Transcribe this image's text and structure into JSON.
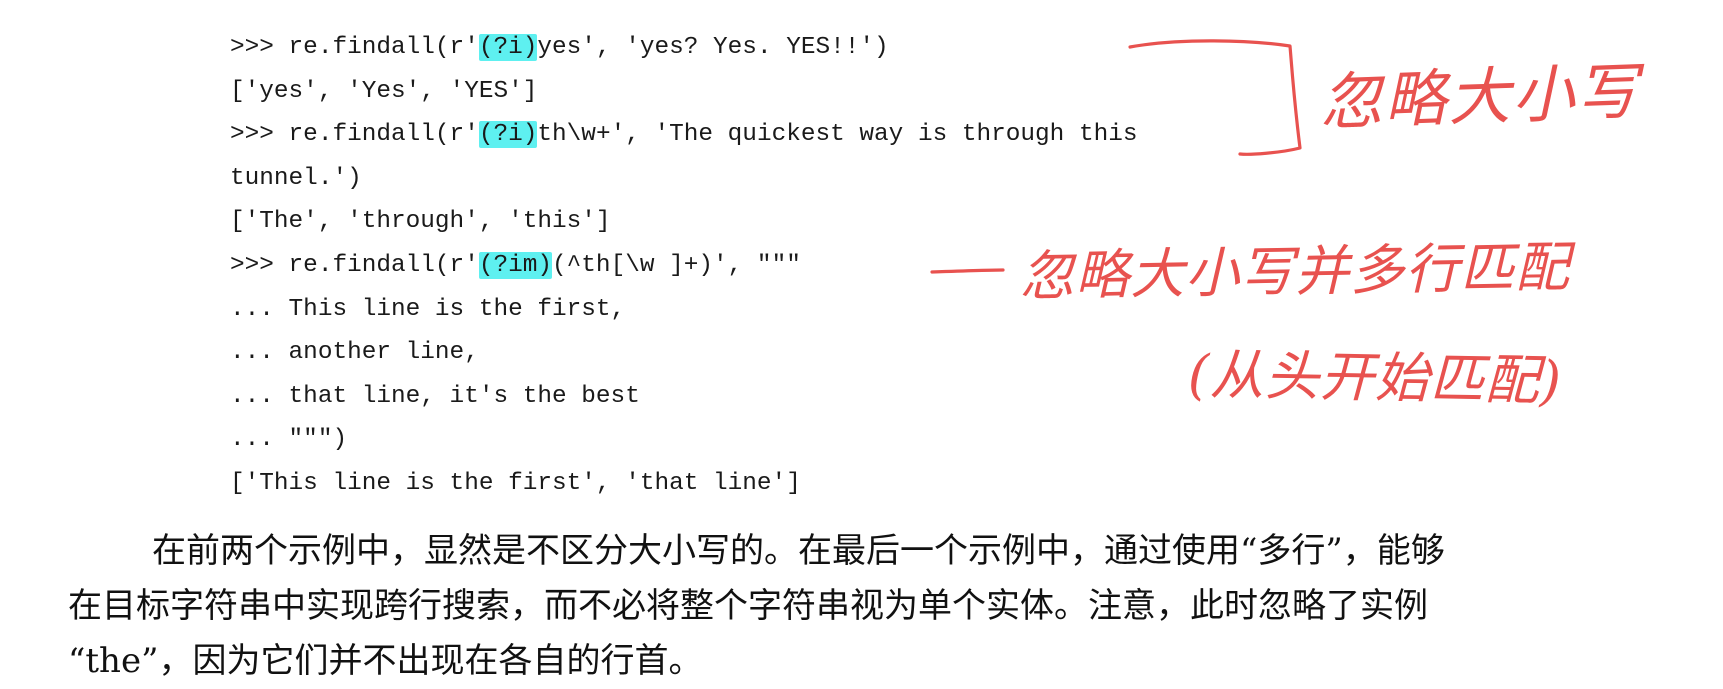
{
  "code": {
    "line1": {
      "pre": ">>> re.findall(r'",
      "flag": "(?i)",
      "post": "yes', 'yes? Yes. YES!!')"
    },
    "line2": "['yes', 'Yes', 'YES']",
    "line3": {
      "pre": ">>> re.findall(r'",
      "flag": "(?i)",
      "post": "th\\w+', 'The quickest way is through this"
    },
    "line4": "tunnel.')",
    "line5": "['The', 'through', 'this']",
    "line6": {
      "pre": ">>> re.findall(r'",
      "flag": "(?im)",
      "post": "(^th[\\w ]+)', \"\"\""
    },
    "line7": "... This line is the first,",
    "line8": "... another line,",
    "line9": "... that line, it's the best",
    "line10": "... \"\"\")",
    "line11": "['This line is the first', 'that line']"
  },
  "annotations": {
    "note1": "忽略大小写",
    "note2": "忽略大小写并多行匹配",
    "note3": "(从头开始匹配)",
    "highlight_color": "#5ef0f0",
    "ink_color": "#e8524f"
  },
  "prose": {
    "line1": "在前两个示例中，显然是不区分大小写的。在最后一个示例中，通过使用“多行”，能够",
    "line2": "在目标字符串中实现跨行搜索，而不必将整个字符串视为单个实体。注意，此时忽略了实例",
    "line3": "“the”，因为它们并不出现在各自的行首。"
  }
}
